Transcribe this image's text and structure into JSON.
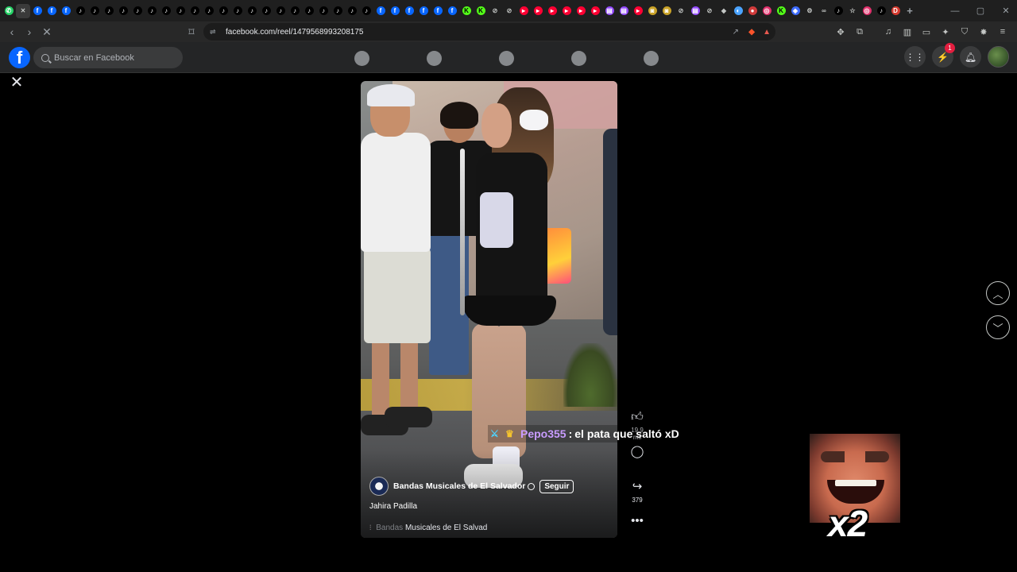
{
  "browser": {
    "url": "facebook.com/reel/1479568993208175",
    "tab_glyphs": [
      "whatsapp",
      "active",
      "fb",
      "fb",
      "fb",
      "tiktok",
      "tiktok",
      "tiktok",
      "tiktok",
      "tiktok",
      "tiktok",
      "tiktok",
      "tiktok",
      "tiktok",
      "tiktok",
      "tiktok",
      "tiktok",
      "tiktok",
      "tiktok",
      "tiktok",
      "tiktok",
      "tiktok",
      "tiktok",
      "tiktok",
      "tiktok",
      "tiktok",
      "fb",
      "fb",
      "fb",
      "fb",
      "fb",
      "fb",
      "kick",
      "kick",
      "muted",
      "muted",
      "youtube",
      "youtube",
      "youtube",
      "youtube",
      "youtube",
      "youtube",
      "twitch",
      "twitch",
      "youtube",
      "bot",
      "bot",
      "muted",
      "twitch",
      "muted",
      "diamond",
      "color",
      "circle",
      "instagram",
      "kick",
      "shield",
      "gear",
      "other",
      "tiktok",
      "star",
      "instagram",
      "tiktok",
      "d"
    ]
  },
  "facebook": {
    "logo": "f",
    "search_placeholder": "Buscar en Facebook",
    "notification_count": "1"
  },
  "reel": {
    "page_name": "Bandas Musicales de El Salvador",
    "follow_label": "Seguir",
    "author": "Jahira Padilla",
    "audio_dim": "Bandas",
    "audio_text": "Musicales de El Salvad",
    "likes": "19,9 mil",
    "shares": "379"
  },
  "overlay": {
    "chat_user": "Pepo355",
    "chat_sep": ":",
    "chat_message": "el pata que saltó xD",
    "multiplier": "x2"
  },
  "icons": {
    "like": "thumbs-up-icon",
    "comment": "comment-icon",
    "share": "share-icon",
    "more": "more-icon",
    "prev": "chevron-up-icon",
    "next": "chevron-down-icon",
    "close": "close-icon"
  },
  "colors": {
    "fb_blue": "#0866ff",
    "chat_user": "#c99cff",
    "badge": "#e41e3f"
  }
}
